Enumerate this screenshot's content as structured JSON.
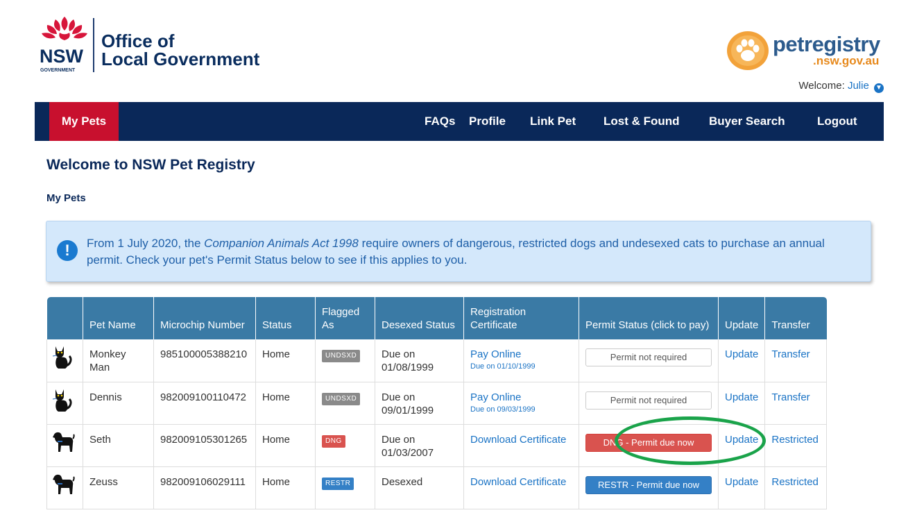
{
  "header": {
    "nsw_logo_text": "NSW",
    "nsw_logo_subtext": "GOVERNMENT",
    "org_line1": "Office of",
    "org_line2": "Local Government",
    "registry_main": "petregistry",
    "registry_sub": ".nsw.gov.au",
    "welcome_label": "Welcome:",
    "user_name": "Julie"
  },
  "nav": {
    "active": "My Pets",
    "items": [
      "FAQs",
      "Profile",
      "Link Pet",
      "Lost & Found",
      "Buyer Search",
      "Logout"
    ]
  },
  "page": {
    "title": "Welcome to NSW Pet Registry",
    "section": "My Pets"
  },
  "notice": {
    "prefix": "From 1 July 2020, the ",
    "act": "Companion Animals Act 1998",
    "suffix": " require owners of dangerous, restricted dogs and undesexed cats to purchase an annual permit. Check your pet's Permit Status below to see if this applies to you."
  },
  "table": {
    "headers": [
      "",
      "Pet Name",
      "Microchip Number",
      "Status",
      "Flagged As",
      "Desexed Status",
      "Registration Certificate",
      "Permit Status (click to pay)",
      "Update",
      "Transfer"
    ],
    "rows": [
      {
        "icon": "cat-icon",
        "name": "Monkey Man",
        "microchip": "985100005388210",
        "status": "Home",
        "flag": "UNDSXD",
        "desexed": "Due on 01/08/1999",
        "cert": "Pay Online",
        "cert_due": "Due on 01/10/1999",
        "permit": "Permit not required",
        "update": "Update",
        "transfer": "Transfer"
      },
      {
        "icon": "cat-icon",
        "name": "Dennis",
        "microchip": "982009100110472",
        "status": "Home",
        "flag": "UNDSXD",
        "desexed": "Due on 09/01/1999",
        "cert": "Pay Online",
        "cert_due": "Due on 09/03/1999",
        "permit": "Permit not required",
        "update": "Update",
        "transfer": "Transfer"
      },
      {
        "icon": "dog-icon",
        "name": "Seth",
        "microchip": "982009105301265",
        "status": "Home",
        "flag": "DNG",
        "desexed": "Due on 01/03/2007",
        "cert": "Download Certificate",
        "cert_due": "",
        "permit": "DNG - Permit due now",
        "update": "Update",
        "transfer": "Restricted"
      },
      {
        "icon": "dog-icon",
        "name": "Zeuss",
        "microchip": "982009106029111",
        "status": "Home",
        "flag": "RESTR",
        "desexed": "Desexed",
        "cert": "Download Certificate",
        "cert_due": "",
        "permit": "RESTR - Permit due now",
        "update": "Update",
        "transfer": "Restricted"
      }
    ]
  },
  "colors": {
    "navy": "#0a2859",
    "nav_active": "#c8102e",
    "table_header": "#3a7aa5",
    "link": "#1a73c5",
    "highlight_ring": "#1aa34a",
    "badge_gray": "#8a8a8a",
    "badge_red": "#d9534f",
    "badge_blue": "#3480c6"
  }
}
